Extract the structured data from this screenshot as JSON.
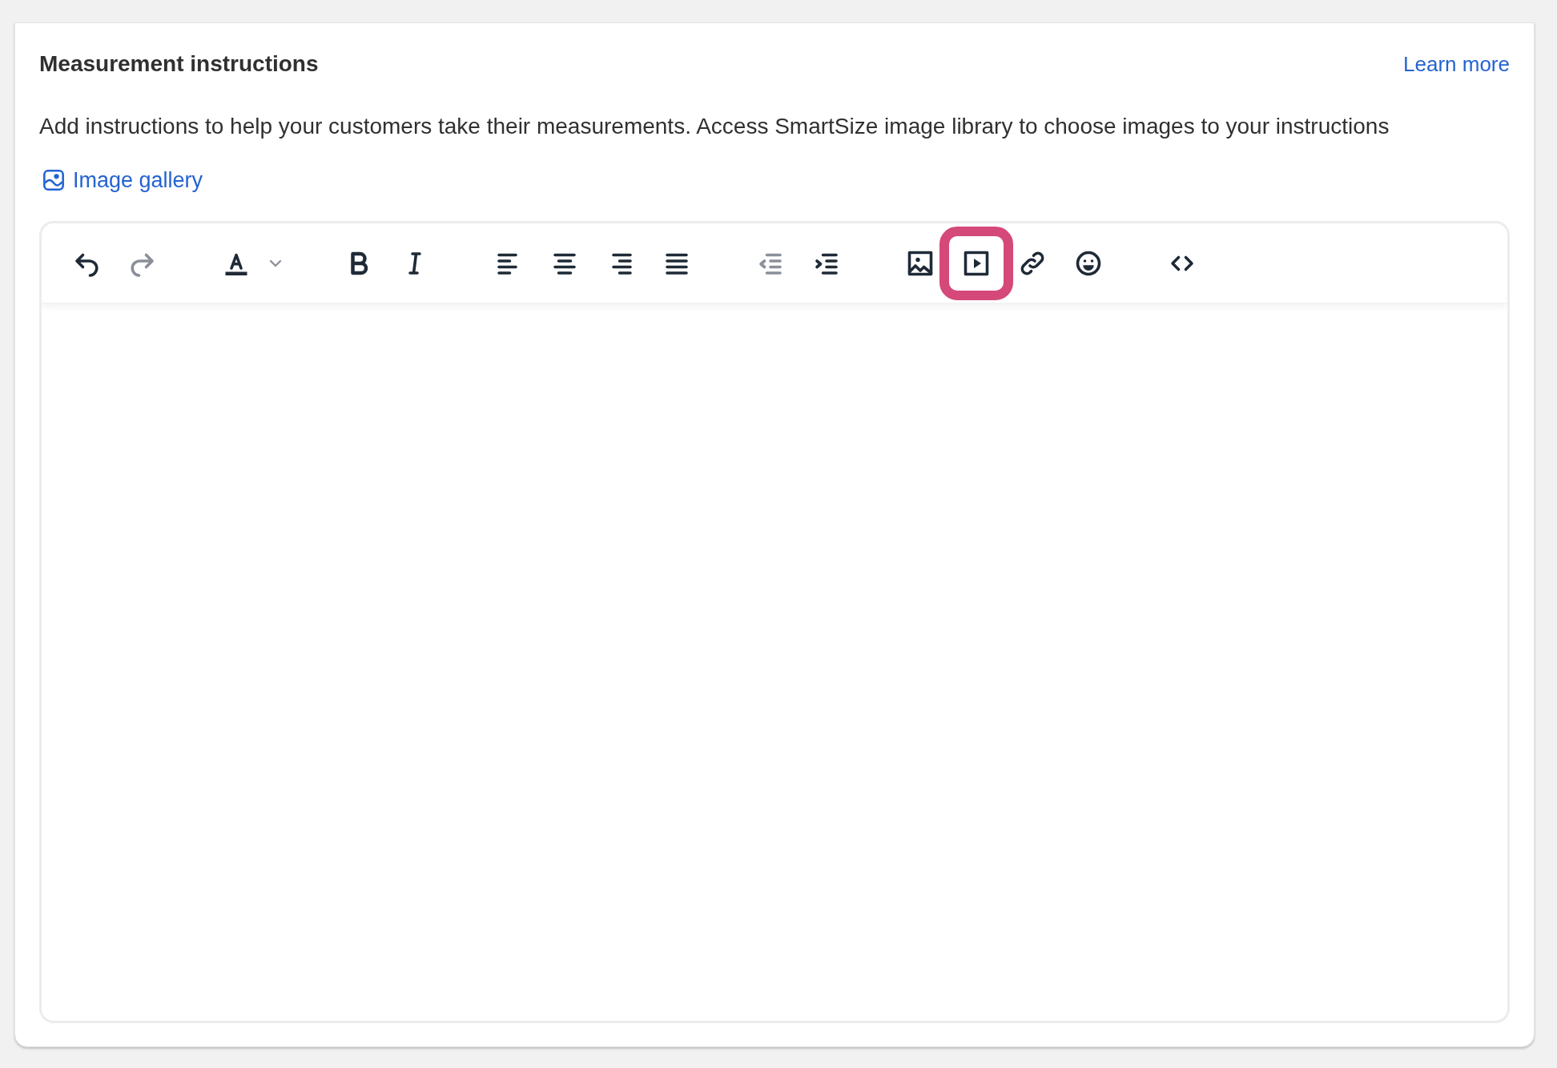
{
  "card": {
    "title": "Measurement instructions",
    "learn_more": "Learn more",
    "description": "Add instructions to help your customers take their measurements. Access SmartSize image library to choose images to your instructions",
    "image_gallery": "Image gallery"
  },
  "editor": {
    "toolbar_groups": [
      {
        "items": [
          {
            "kind": "undo",
            "disabled": false,
            "highlighted": false
          },
          {
            "kind": "redo",
            "disabled": true,
            "highlighted": false
          }
        ]
      },
      {
        "items": [
          {
            "kind": "text-color",
            "disabled": false,
            "highlighted": false
          },
          {
            "kind": "dropdown",
            "disabled": true,
            "highlighted": false
          }
        ]
      },
      {
        "items": [
          {
            "kind": "bold",
            "disabled": false,
            "highlighted": false
          },
          {
            "kind": "italic",
            "disabled": false,
            "highlighted": false
          }
        ]
      },
      {
        "items": [
          {
            "kind": "align-left",
            "disabled": false,
            "highlighted": false
          },
          {
            "kind": "align-center",
            "disabled": false,
            "highlighted": false
          },
          {
            "kind": "align-right",
            "disabled": false,
            "highlighted": false
          },
          {
            "kind": "justify",
            "disabled": false,
            "highlighted": false
          }
        ]
      },
      {
        "items": [
          {
            "kind": "outdent",
            "disabled": true,
            "highlighted": false
          },
          {
            "kind": "indent",
            "disabled": false,
            "highlighted": false
          }
        ]
      },
      {
        "items": [
          {
            "kind": "image",
            "disabled": false,
            "highlighted": false
          },
          {
            "kind": "video",
            "disabled": false,
            "highlighted": true
          },
          {
            "kind": "link",
            "disabled": false,
            "highlighted": false
          },
          {
            "kind": "emoji",
            "disabled": false,
            "highlighted": false
          }
        ]
      },
      {
        "items": [
          {
            "kind": "code",
            "disabled": false,
            "highlighted": false
          }
        ]
      }
    ]
  }
}
